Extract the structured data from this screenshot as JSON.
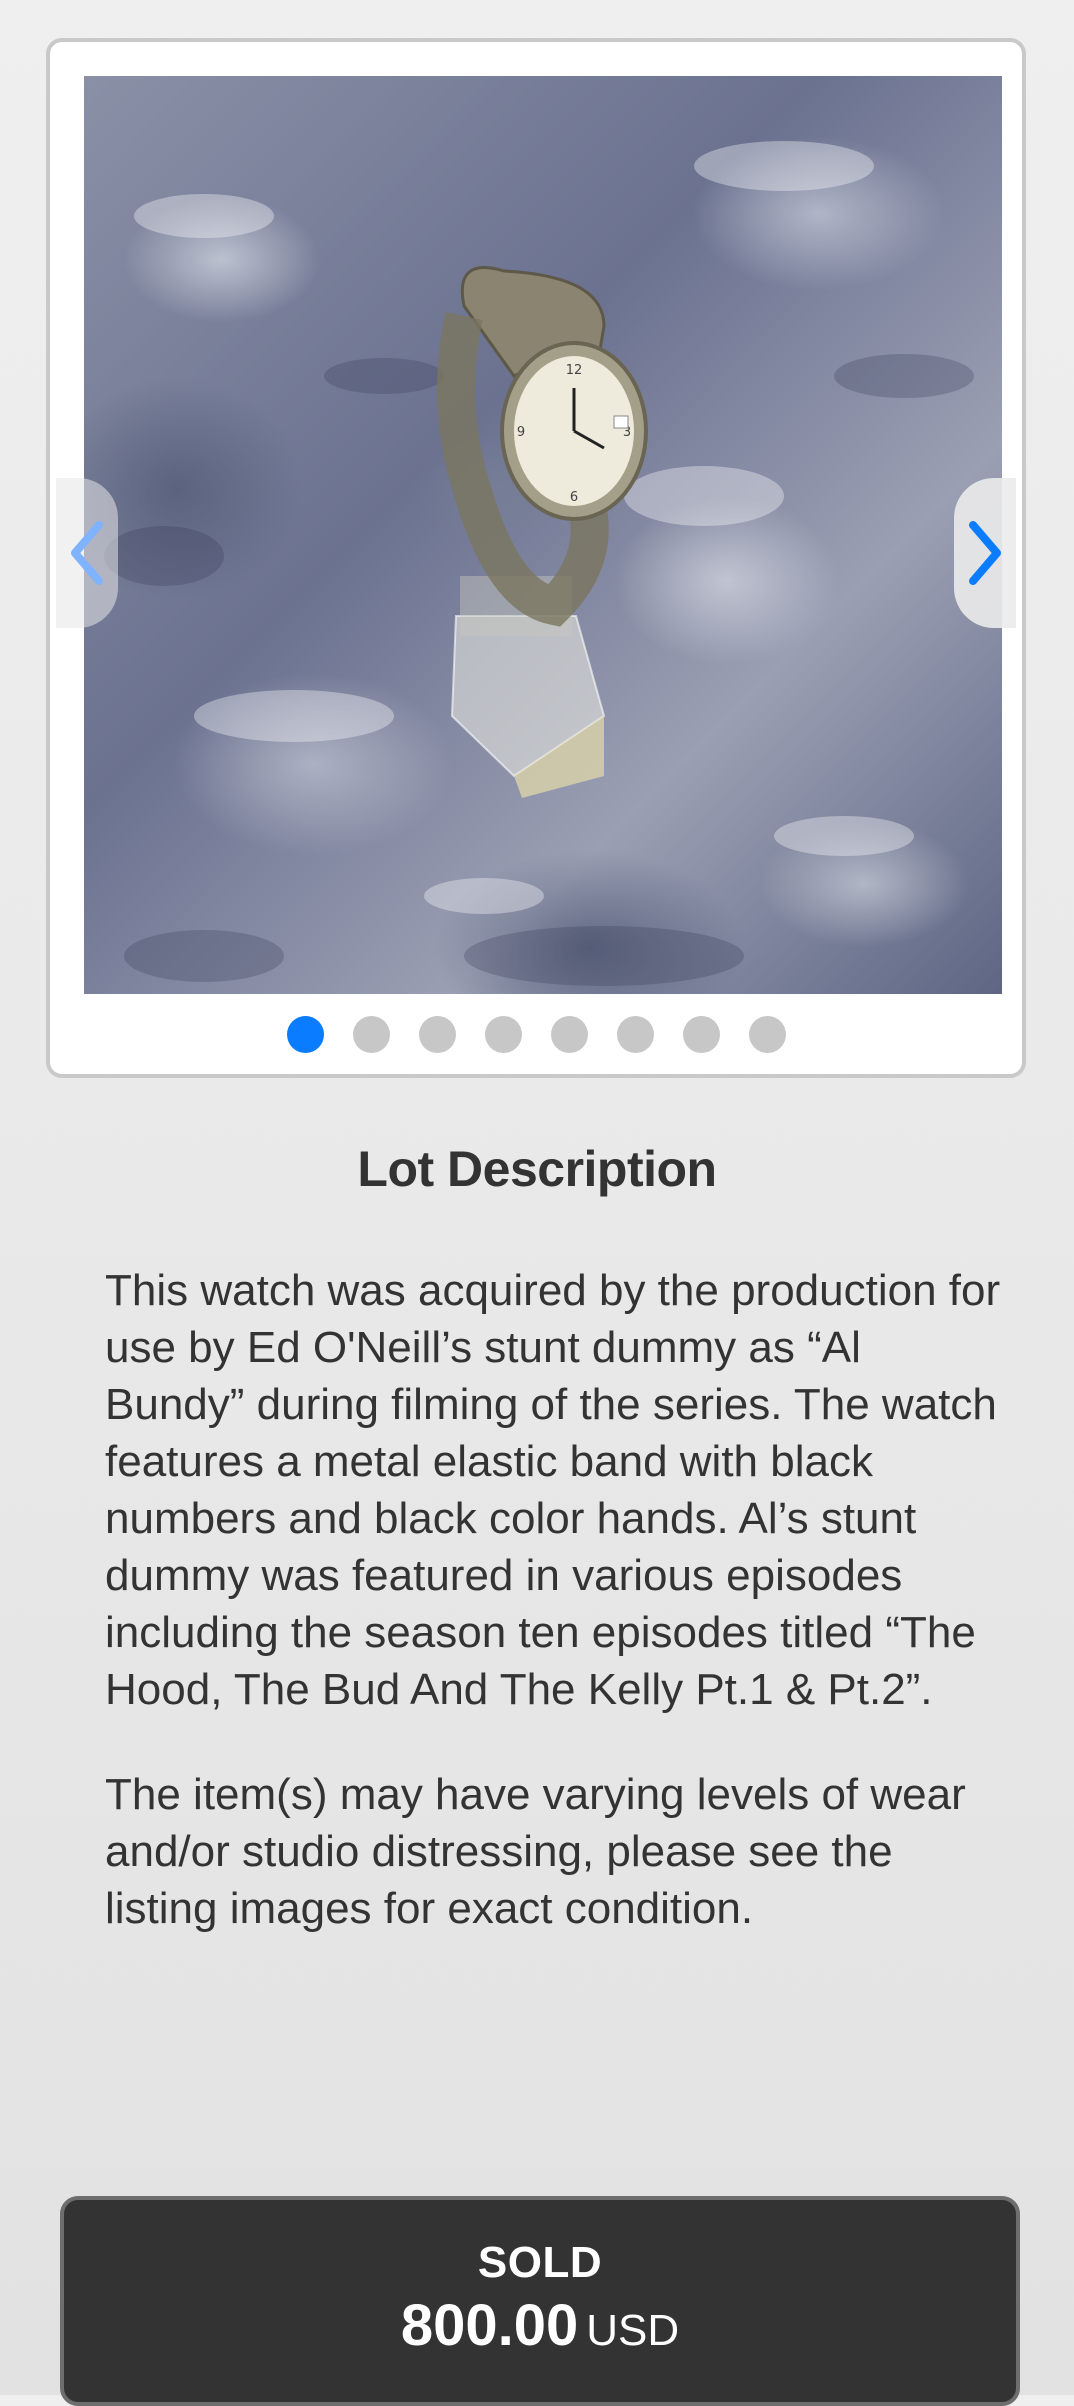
{
  "gallery": {
    "image_alt": "Watch on clear acrylic stand against grey textured background",
    "image_count": 8,
    "active_index": 0,
    "prev_icon": "chevron-left-icon",
    "next_icon": "chevron-right-icon",
    "active_dot_color": "#0a7cff",
    "inactive_dot_color": "#c7c7c7"
  },
  "lot": {
    "title": "Lot Description",
    "paragraphs": [
      "This watch was acquired by the production for use by Ed O'Neill’s stunt dummy as “Al Bundy” during filming of the series. The watch features a metal elastic band with black numbers and black color hands. Al’s stunt dummy was featured in various episodes including the season ten episodes titled “The Hood, The Bud And The Kelly Pt.1 & Pt.2”.",
      "The item(s) may have varying levels of wear and/or studio distressing, please see the listing images for exact condition."
    ]
  },
  "sale": {
    "status": "SOLD",
    "price": "800.00",
    "currency": "USD"
  }
}
